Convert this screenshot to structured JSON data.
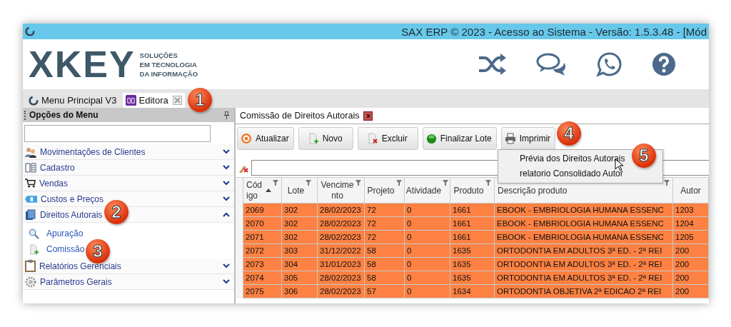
{
  "window": {
    "title": "SAX ERP © 2023 - Acesso ao Sistema - Versão: 1.5.3.48 - [Mód"
  },
  "logo": {
    "mark": "XKEY",
    "tagline": [
      "SOLUÇÕES",
      "EM TECNOLOGIA",
      "DA INFORMAÇÃO"
    ]
  },
  "tabs": [
    {
      "label": "Menu Principal V3",
      "selected": false
    },
    {
      "label": "Editora",
      "selected": true
    }
  ],
  "sidebar": {
    "title": "Opções do Menu",
    "items": [
      {
        "label": "Movimentações de Clientes",
        "expanded": false
      },
      {
        "label": "Cadastro",
        "expanded": false
      },
      {
        "label": "Vendas",
        "expanded": false
      },
      {
        "label": "Custos e Preços",
        "expanded": false
      },
      {
        "label": "Direitos Autorais",
        "expanded": true,
        "children": [
          {
            "label": "Apuração"
          },
          {
            "label": "Comissão"
          }
        ]
      },
      {
        "label": "Relatórios Gerenciais",
        "expanded": false
      },
      {
        "label": "Parâmetros Gerais",
        "expanded": false
      }
    ]
  },
  "document_tab": {
    "label": "Comissão de Direitos Autorais",
    "close": "x"
  },
  "toolbar": [
    "Atualizar",
    "Novo",
    "Excluir",
    "Finalizar Lote",
    "Imprimir"
  ],
  "print_menu": [
    "Prévia dos Direitos Autorais",
    "relatorio Consolidado Autor"
  ],
  "table": {
    "columns": [
      {
        "label": "Código",
        "sorted": true,
        "filter": true
      },
      {
        "label": "Lote",
        "sorted": false,
        "filter": true
      },
      {
        "label": "Vencimento",
        "sorted": false,
        "filter": true
      },
      {
        "label": "Projeto",
        "sorted": false,
        "filter": true
      },
      {
        "label": "Atividade",
        "sorted": false,
        "filter": true
      },
      {
        "label": "Produto",
        "sorted": false,
        "filter": true
      },
      {
        "label": "Descrição produto",
        "sorted": false,
        "filter": true
      },
      {
        "label": "Autor",
        "sorted": false,
        "filter": false
      }
    ],
    "rows": [
      [
        "2069",
        "302",
        "28/02/2023",
        "72",
        "0",
        "1661",
        "EBOOK - EMBRIOLOGIA HUMANA ESSENC",
        "1203"
      ],
      [
        "2070",
        "302",
        "28/02/2023",
        "72",
        "0",
        "1661",
        "EBOOK - EMBRIOLOGIA HUMANA ESSENC",
        "1204"
      ],
      [
        "2071",
        "302",
        "28/02/2023",
        "72",
        "0",
        "1661",
        "EBOOK - EMBRIOLOGIA HUMANA ESSENC",
        "1205"
      ],
      [
        "2072",
        "303",
        "31/12/2022",
        "58",
        "0",
        "1635",
        "ORTODONTIA EM ADULTOS 3ª ED. - 2ª REI",
        "200"
      ],
      [
        "2073",
        "304",
        "31/01/2023",
        "58",
        "0",
        "1635",
        "ORTODONTIA EM ADULTOS 3ª ED. - 2ª REI",
        "200"
      ],
      [
        "2074",
        "305",
        "28/02/2023",
        "58",
        "0",
        "1635",
        "ORTODONTIA EM ADULTOS 3ª ED. - 2ª REI",
        "200"
      ],
      [
        "2075",
        "306",
        "28/02/2023",
        "57",
        "0",
        "1634",
        "ORTODONTIA OBJETIVA 2ª EDICAO 2ª REI",
        "200"
      ]
    ]
  },
  "callouts": [
    "1",
    "2",
    "3",
    "4",
    "5"
  ]
}
